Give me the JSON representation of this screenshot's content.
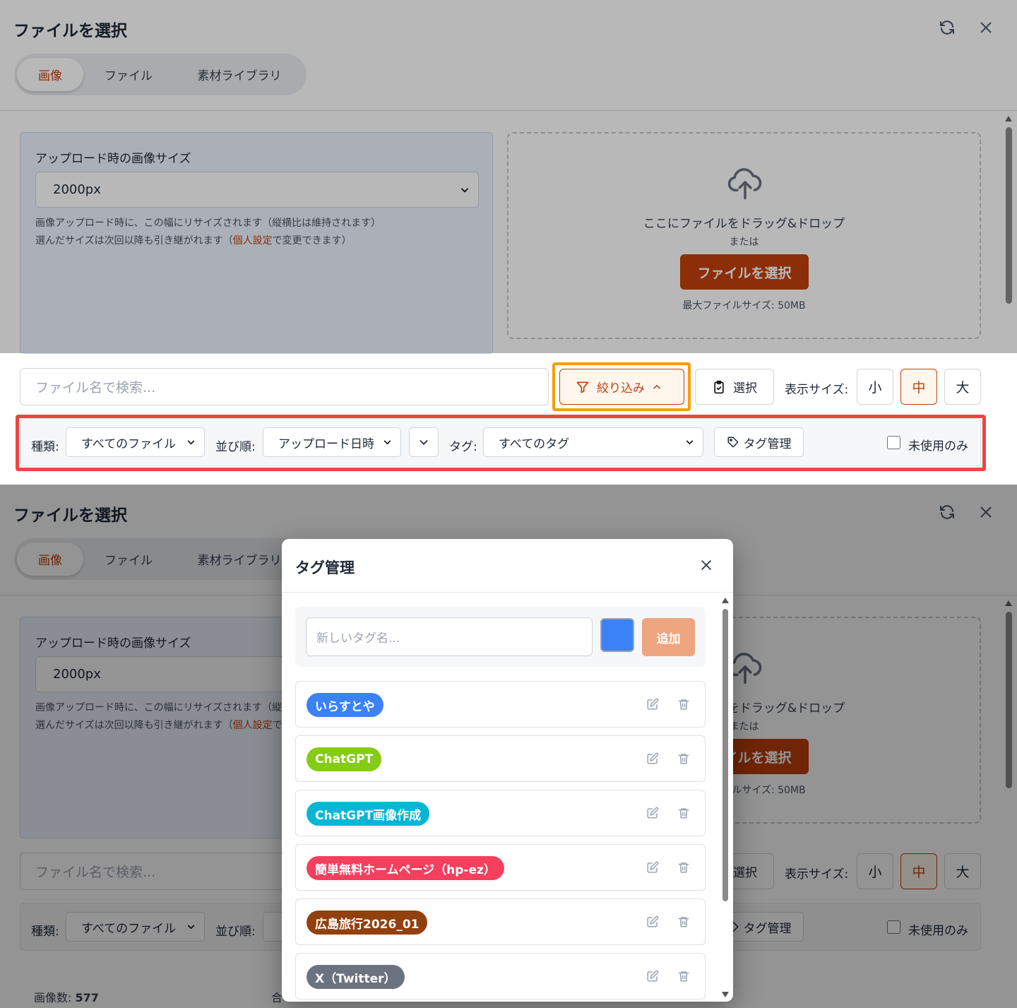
{
  "dialog": {
    "title": "ファイルを選択",
    "tabs": [
      "画像",
      "ファイル",
      "素材ライブラリ"
    ]
  },
  "upload_size": {
    "label": "アップロード時の画像サイズ",
    "value": "2000px",
    "help1": "画像アップロード時に、この幅にリサイズされます（縦横比は維持されます）",
    "help2_before": "選んだサイズは次回以降も引き継がれます（",
    "help2_link": "個人設定",
    "help2_after": "で変更できます）"
  },
  "dropzone": {
    "text": "ここにファイルをドラッグ&ドロップ",
    "or": "または",
    "button": "ファイルを選択",
    "max": "最大ファイルサイズ: 50MB"
  },
  "toolbar": {
    "search_placeholder": "ファイル名で検索...",
    "filter_label": "絞り込み",
    "select_label": "選択",
    "display_size_label": "表示サイズ:",
    "sizes": [
      "小",
      "中",
      "大"
    ]
  },
  "filters": {
    "type_label": "種類:",
    "type_value": "すべてのファイル",
    "sort_label": "並び順:",
    "sort_value": "アップロード日時",
    "tag_label": "タグ:",
    "tag_value": "すべてのタグ",
    "tag_manage": "タグ管理",
    "unused_only": "未使用のみ"
  },
  "counts": {
    "images_label": "画像数:",
    "images_value": "577",
    "total_fragment": "合"
  },
  "tag_modal": {
    "title": "タグ管理",
    "input_placeholder": "新しいタグ名...",
    "color": "#3b82f6",
    "add_label": "追加",
    "tags": [
      {
        "name": "いらすとや",
        "color": "#3b82f6"
      },
      {
        "name": "ChatGPT",
        "color": "#84cc16"
      },
      {
        "name": "ChatGPT画像作成",
        "color": "#06b6d4"
      },
      {
        "name": "簡単無料ホームページ（hp-ez）",
        "color": "#f43f5e"
      },
      {
        "name": "広島旅行2026_01",
        "color": "#92400e"
      },
      {
        "name": "X（Twitter）",
        "color": "#6b7280"
      }
    ]
  }
}
